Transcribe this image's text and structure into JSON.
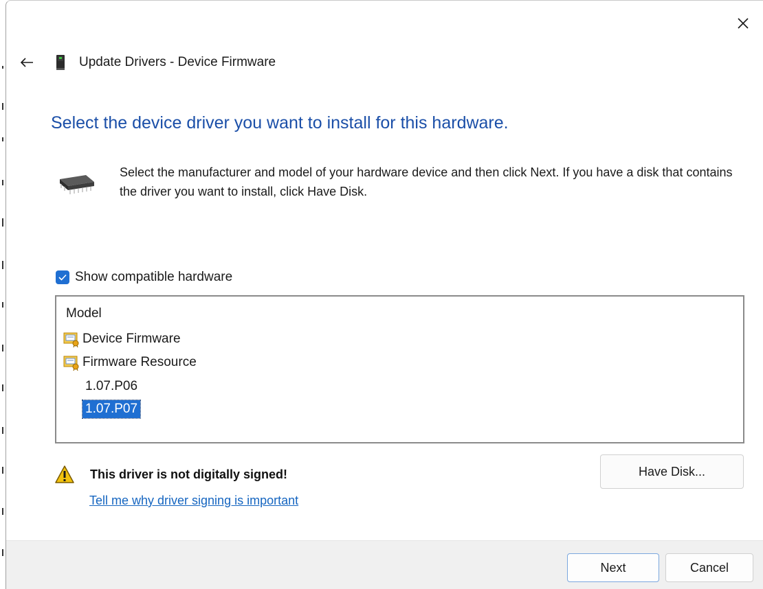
{
  "window": {
    "title": "Update Drivers - Device Firmware"
  },
  "icons": {
    "close": "close-icon",
    "back": "back-arrow-icon",
    "device": "device-icon",
    "chip": "chip-icon",
    "checkbox": "checkmark-icon",
    "certificate": "certificate-icon",
    "warning": "warning-icon"
  },
  "colors": {
    "title_blue": "#1b4fa8",
    "accent": "#1f6fd2",
    "link": "#1565c0",
    "warning_yellow": "#f2c20e"
  },
  "main": {
    "heading": "Select the device driver you want to install for this hardware.",
    "instructions": "Select the manufacturer and model of your hardware device and then click Next. If you have a disk that contains the driver you want to install, click Have Disk."
  },
  "compatible": {
    "label": "Show compatible hardware",
    "checked": true
  },
  "model_list": {
    "header": "Model",
    "items": [
      {
        "label": "Device Firmware",
        "type": "group"
      },
      {
        "label": "Firmware Resource",
        "type": "group"
      },
      {
        "label": "1.07.P06",
        "type": "version"
      },
      {
        "label": "1.07.P07",
        "type": "version",
        "selected": true
      }
    ]
  },
  "warning": {
    "text": "This driver is not digitally signed!",
    "link": "Tell me why driver signing is important"
  },
  "buttons": {
    "have_disk": "Have Disk...",
    "next": "Next",
    "cancel": "Cancel"
  }
}
